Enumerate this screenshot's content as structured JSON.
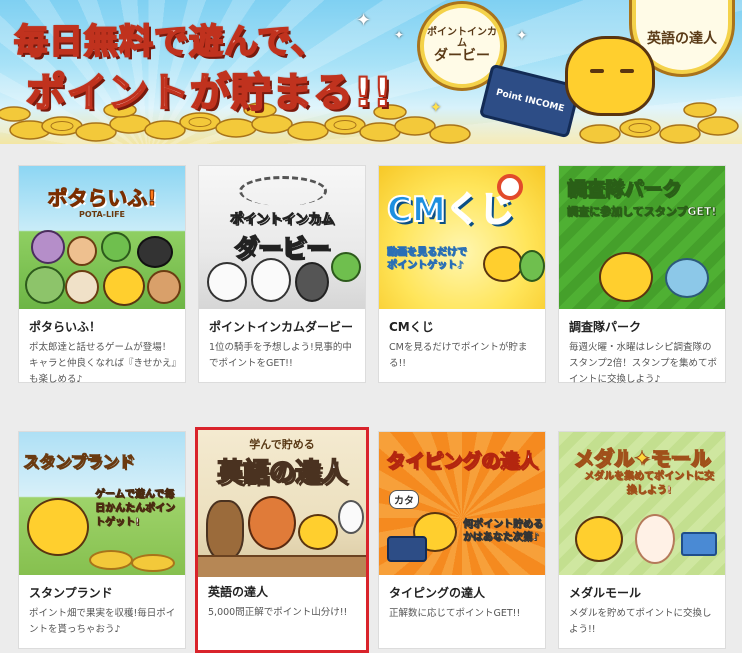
{
  "banner": {
    "line1": "毎日無料で遊んで、",
    "line2": "ポイントが貯まる!!",
    "medal_derby_top": "ポイントインカム",
    "medal_derby_bottom": "ダービー",
    "medal_eigo": "英語の達人",
    "laptop_text": "Point INCOME"
  },
  "games": [
    {
      "title": "ポタらいふ！",
      "description": "ポ太郎達と話せるゲームが登場！\nキャラと仲良くなれば『きせかえ』も楽しめる♪",
      "art_title": "ポタらいふ!",
      "art_sub": "POTA-LIFE"
    },
    {
      "title": "ポイントインカムダービー",
      "description": "1位の騎手を予想しよう!見事的中でポイントをGET!!",
      "art_title_top": "ポイントインカム",
      "art_title_bottom": "ダービー"
    },
    {
      "title": "CMくじ",
      "description": "CMを見るだけでポイントが貯まる!!",
      "art_title": "CMくじ",
      "art_sub": "動画を見るだけでポイントゲット♪"
    },
    {
      "title": "調査隊パーク",
      "description": "毎週火曜・水曜はレシピ調査隊のスタンプ2倍！スタンプを集めてポイントに交換しよう♪",
      "art_title": "調査隊パーク",
      "art_sub": "調査に参加してスタンプGET!"
    },
    {
      "title": "スタンプランド",
      "description": "ポイント畑で果実を収穫!毎日ポイントを貰っちゃおう♪",
      "art_title": "スタンプランド",
      "art_sub": "ゲームで遊んで毎日かんたんポイントゲット!"
    },
    {
      "title": "英語の達人",
      "description": "5,000問正解でポイント山分け!!",
      "art_title": "英語の達人",
      "art_sub": "学んで貯める"
    },
    {
      "title": "タイピングの達人",
      "description": "正解数に応じてポイントGET!!",
      "art_title": "タイピングの達人",
      "art_sub": "何ポイント貯めるかはあなた次第♪",
      "art_bubble": "カタ"
    },
    {
      "title": "メダルモール",
      "description": "メダルを貯めてポイントに交換しよう!!",
      "art_title": "メダル✦モール",
      "art_sub": "メダルを集めてポイントに交換しよう!"
    }
  ],
  "colors": {
    "selected_border": "#d9232b",
    "banner_title_stroke": "#c0321e",
    "page_bg": "#ececec"
  },
  "icons": [
    "sparkle-icon",
    "coin-icon",
    "mascot-icon",
    "laptop-icon"
  ]
}
